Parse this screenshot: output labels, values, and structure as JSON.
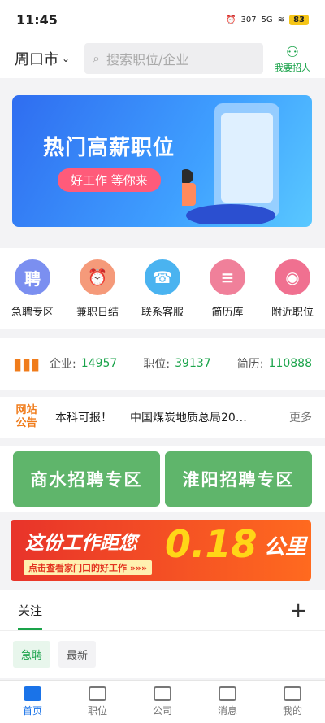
{
  "status": {
    "time": "11:45",
    "speed": "307",
    "speed_unit": "KB/s",
    "network": "5G",
    "battery": "83"
  },
  "header": {
    "city": "周口市",
    "search_placeholder": "搜索职位/企业",
    "recruit_label": "我要招人"
  },
  "banner": {
    "title": "热门高薪职位",
    "slogan": "好工作 等你来"
  },
  "quick_links": [
    {
      "label": "急聘专区",
      "icon_text": "聘",
      "color": "#7b8ff0"
    },
    {
      "label": "兼职日结",
      "icon_text": "⏰",
      "color": "#f59a7a"
    },
    {
      "label": "联系客服",
      "icon_text": "☎",
      "color": "#4ab3f0"
    },
    {
      "label": "简历库",
      "icon_text": "≡",
      "color": "#f0809a"
    },
    {
      "label": "附近职位",
      "icon_text": "◉",
      "color": "#f07090"
    }
  ],
  "stats": {
    "company_label": "企业:",
    "company_value": "14957",
    "job_label": "职位:",
    "job_value": "39137",
    "resume_label": "简历:",
    "resume_value": "110888"
  },
  "notice": {
    "tag": "网站公告",
    "items": [
      "本科可报！",
      "中国煤炭地质总局20…"
    ],
    "more": "更多"
  },
  "zones": [
    "商水招聘专区",
    "淮阳招聘专区"
  ],
  "promo": {
    "headline": "这份工作距您",
    "distance": "0.18",
    "unit": "公里",
    "subline": "点击查看家门口的好工作 »»»"
  },
  "follow": {
    "tab": "关注",
    "add": "+",
    "chips": [
      "急聘",
      "最新"
    ]
  },
  "bottom_nav": [
    {
      "label": "首页",
      "active": true
    },
    {
      "label": "职位",
      "active": false
    },
    {
      "label": "公司",
      "active": false
    },
    {
      "label": "消息",
      "active": false
    },
    {
      "label": "我的",
      "active": false
    }
  ]
}
